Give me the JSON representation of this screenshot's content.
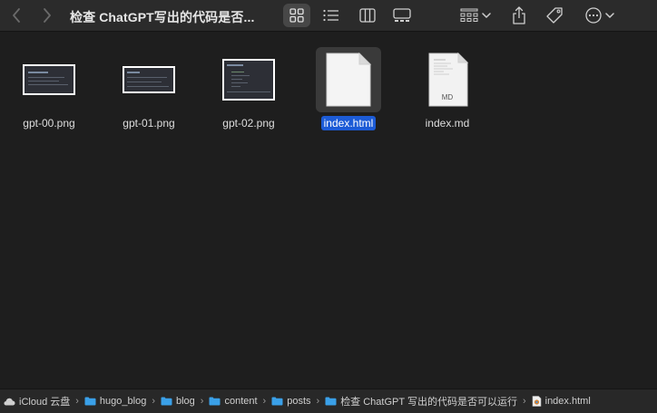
{
  "window": {
    "title": "检查 ChatGPT写出的代码是否..."
  },
  "toolbar": {
    "view_modes": [
      "icons",
      "list",
      "columns",
      "gallery"
    ],
    "active_view": "icons"
  },
  "files": [
    {
      "name": "gpt-00.png",
      "kind": "image"
    },
    {
      "name": "gpt-01.png",
      "kind": "image"
    },
    {
      "name": "gpt-02.png",
      "kind": "image"
    },
    {
      "name": "index.html",
      "kind": "document",
      "selected": true
    },
    {
      "name": "index.md",
      "kind": "document",
      "badge": "MD"
    }
  ],
  "pathbar": {
    "items": [
      {
        "label": "iCloud 云盘",
        "icon": "cloud-icon"
      },
      {
        "label": "hugo_blog",
        "icon": "folder-icon"
      },
      {
        "label": "blog",
        "icon": "folder-icon"
      },
      {
        "label": "content",
        "icon": "folder-icon"
      },
      {
        "label": "posts",
        "icon": "folder-icon"
      },
      {
        "label": "检查 ChatGPT 写出的代码是否可以运行",
        "icon": "folder-icon"
      },
      {
        "label": "index.html",
        "icon": "html-file-icon"
      }
    ]
  },
  "colors": {
    "selection": "#1c5bd6",
    "folder": "#3aa0e8",
    "background": "#1e1e1e",
    "toolbar": "#2b2b2b"
  }
}
